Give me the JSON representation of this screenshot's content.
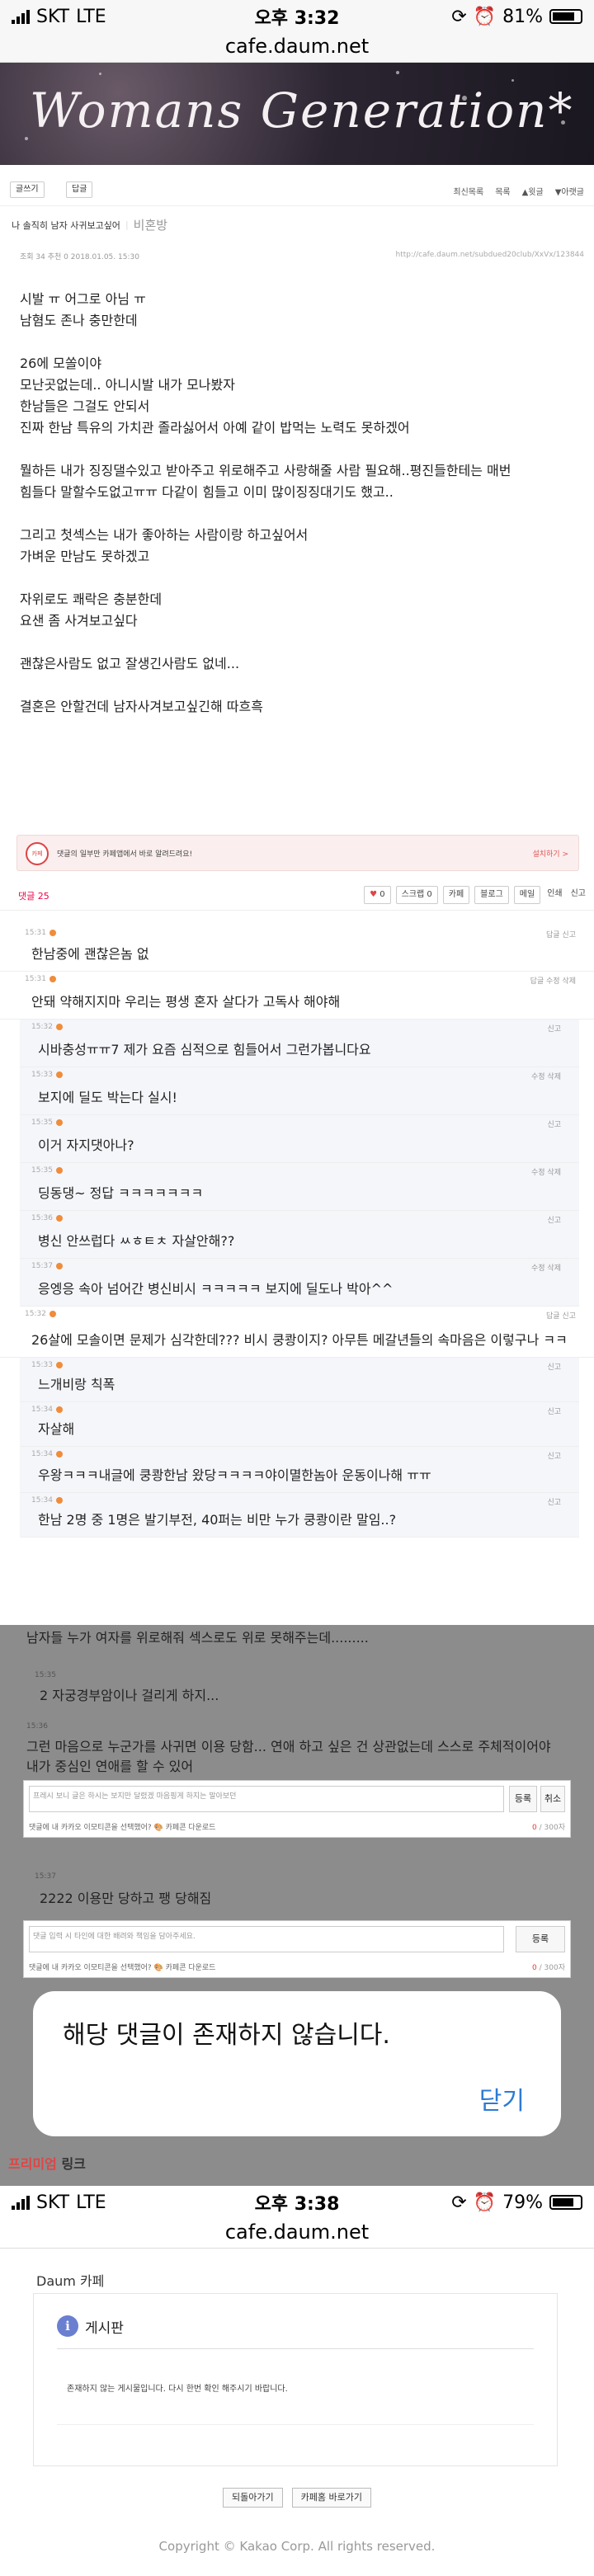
{
  "status1": {
    "carrier": "SKT",
    "network": "LTE",
    "time": "오후 3:32",
    "battery": "81%",
    "battery_level": 0.81
  },
  "url1": "cafe.daum.net",
  "banner": {
    "logo_text": "Womans Generation*"
  },
  "toolbar": {
    "write": "글쓰기",
    "reply": "답글",
    "right": [
      "최신목록",
      "목록",
      "▲윗글",
      "▼아랫글"
    ]
  },
  "crumbs": {
    "category": "나 솔직히 남자 사귀보고싶어",
    "board": "비혼방"
  },
  "meta": {
    "info": "조회 34 추천 0 2018.01.05. 15:30",
    "link": "http://cafe.daum.net/subdued20club/XxVx/123844"
  },
  "post": {
    "paragraphs": [
      "시발 ㅠ 어그로 아님 ㅠ\n남혐도 존나 충만한데",
      "26에 모쏠이야\n모난곳없는데.. 아니시발 내가 모나봤자\n한남들은 그걸도 안되서\n진짜 한남 특유의 가치관 졸라싫어서 아예 같이 밥먹는 노력도 못하겠어",
      "뭘하든 내가 징징댈수있고 받아주고 위로해주고 사랑해줄 사람 필요해..평진들한테는 매번\n힘들다 말할수도없고ㅠㅠ 다같이 힘들고 이미 많이징징대기도 했고..",
      "그리고 첫섹스는 내가 좋아하는 사람이랑 하고싶어서\n가벼운 만남도 못하겠고",
      "자위로도 쾌락은 충분한데\n요샌 좀 사겨보고싶다",
      "괜찮은사람도 없고 잘생긴사람도 없네...",
      "결혼은 안할건데 남자사겨보고싶긴해 따흐흑"
    ]
  },
  "notice": {
    "badge": "카페",
    "text": "댓글의 일부만 카페앱에서 바로 알려드려요!",
    "more": "설치하기 >"
  },
  "reply_bar": {
    "count": "댓글 25",
    "like": "0",
    "scrap": "스크랩 0",
    "cafe": "카페",
    "blog": "블로그",
    "mail": "메일",
    "print": "인쇄",
    "report": "신고"
  },
  "comments": [
    {
      "time": "15:31",
      "action": "답글 신고",
      "text": "한남중에 괜찮은놈 없",
      "indent": 0
    },
    {
      "time": "15:31",
      "action": "답글 수정 삭제",
      "text": "안돼 약해지지마 우리는 평생 혼자 살다가 고독사 해야해",
      "indent": 0
    },
    {
      "time": "15:32",
      "action": "신고",
      "text": "시바충성ㅠㅠ7 제가 요즘 심적으로 힘들어서 그런가봅니다요",
      "indent": 1
    },
    {
      "time": "15:33",
      "action": "수정 삭제",
      "text": "보지에 딜도 박는다 실시!",
      "indent": 1
    },
    {
      "time": "15:35",
      "action": "신고",
      "text": "이거 자지댓아나?",
      "indent": 1
    },
    {
      "time": "15:35",
      "action": "수정 삭제",
      "text": "딩동댕~ 정답 ㅋㅋㅋㅋㅋㅋㅋ",
      "indent": 1
    },
    {
      "time": "15:36",
      "action": "신고",
      "text": "병신 안쓰럽다 ㅆㅎㅌㅊ 자살안해??",
      "indent": 1
    },
    {
      "time": "15:37",
      "action": "수정 삭제",
      "text": "응엥응 속아 넘어간 병신비시 ㅋㅋㅋㅋㅋ 보지에 딜도나 박아^^",
      "indent": 1
    },
    {
      "time": "15:32",
      "action": "답글 신고",
      "text": "26살에 모솔이면 문제가 심각한데??? 비시 쿵쾅이지? 아무튼 메갈년들의 속마음은 이렇구나 ㅋㅋ",
      "indent": 0
    },
    {
      "time": "15:33",
      "action": "신고",
      "text": "느개비랑 칙폭",
      "indent": 1
    },
    {
      "time": "15:34",
      "action": "신고",
      "text": "자살해",
      "indent": 1
    },
    {
      "time": "15:34",
      "action": "신고",
      "text": "우왕ㅋㅋㅋ내글에 쿵쾅한남 왔당ㅋㅋㅋㅋ야이멸한놈아 운동이나해 ㅠㅠ",
      "indent": 1
    },
    {
      "time": "15:34",
      "action": "신고",
      "text": "한남 2명 중 1명은 발기부전, 40퍼는 비만 누가 쿵쾅이란 말임..?",
      "indent": 1
    }
  ],
  "overlay_comments": [
    {
      "text": "남자들 누가 여자를 위로해줘 섹스로도 위로 못해주는데.........",
      "time": ""
    },
    {
      "time": "15:35",
      "text": "2 자궁경부암이나 걸리게 하지..."
    },
    {
      "time": "15:36",
      "text": "그런 마음으로 누군가를 사귀면 이용 당함... 연애 하고 싶은 건 상관없는데 스스로 주체적이어야\n내가 중심인 연애를 할 수 있어"
    },
    {
      "time": "15:37",
      "text": "2222 이용만 당하고 팽 당해짐"
    }
  ],
  "reply_form1": {
    "placeholder": "프레시 보니 글은 하시는 보지만 달렸겠 마음핑게 하지는 말아보던",
    "submit": "등록",
    "cancel": "취소",
    "options": "댓글에 내 카카오 이모티콘을 선택했어?  🎨 카페콘 다운로드",
    "count": "0",
    "max": "/ 300자"
  },
  "reply_form2": {
    "placeholder": "댓글 입력 시 타인에 대한 배려와 책임을 담아주세요.",
    "submit": "등록",
    "options": "댓글에 내 카카오 이모티콘을 선택했어?  🎨 카페콘 다운로드",
    "count": "0",
    "max": "/ 300자"
  },
  "dialog": {
    "message": "해당 댓글이 존재하지 않습니다.",
    "close": "닫기"
  },
  "premium": {
    "label": "프리미엄",
    "link": " 링크"
  },
  "status2": {
    "carrier": "SKT",
    "network": "LTE",
    "time": "오후 3:38",
    "battery": "79%",
    "battery_level": 0.79
  },
  "url2": "cafe.daum.net",
  "error": {
    "brand": "Daum  카페",
    "title": "게시판",
    "desc": "존재하지 않는 게시물입니다. 다시 한번 확인 해주시기 바랍니다.",
    "back": "되돌아가기",
    "home": "카페홈 바로가기",
    "copyright": "Copyright © Kakao Corp. All rights reserved."
  },
  "colors": {
    "accent": "#e04545",
    "link_blue": "#2c7bd4",
    "orange_dot": "#f08c3a"
  }
}
